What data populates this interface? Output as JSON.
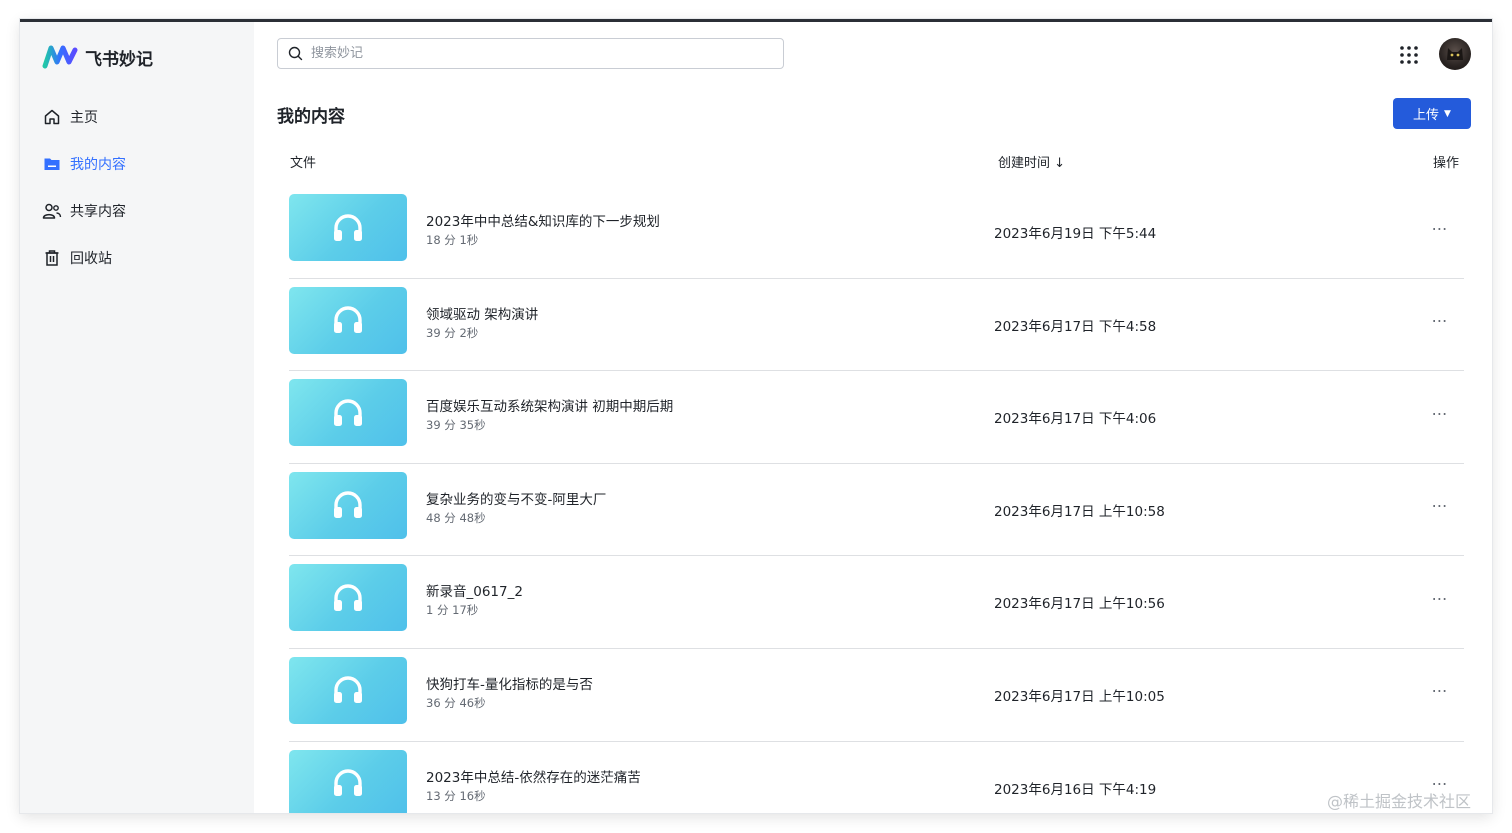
{
  "app": {
    "name": "飞书妙记"
  },
  "sidebar": {
    "items": [
      {
        "label": "主页",
        "icon": "home-icon",
        "active": false
      },
      {
        "label": "我的内容",
        "icon": "folder-icon",
        "active": true
      },
      {
        "label": "共享内容",
        "icon": "users-icon",
        "active": false
      },
      {
        "label": "回收站",
        "icon": "trash-icon",
        "active": false
      }
    ]
  },
  "header": {
    "search_placeholder": "搜索妙记"
  },
  "main": {
    "title": "我的内容",
    "upload_label": "上传",
    "columns": {
      "file": "文件",
      "created": "创建时间 ↓",
      "actions": "操作"
    },
    "rows": [
      {
        "title": "2023年中中总结&知识库的下一步规划",
        "duration": "18 分 1秒",
        "date": "2023年6月19日 下午5:44"
      },
      {
        "title": "领域驱动 架构演讲",
        "duration": "39 分 2秒",
        "date": "2023年6月17日 下午4:58"
      },
      {
        "title": "百度娱乐互动系统架构演讲 初期中期后期",
        "duration": "39 分 35秒",
        "date": "2023年6月17日 下午4:06"
      },
      {
        "title": "复杂业务的变与不变-阿里大厂",
        "duration": "48 分 48秒",
        "date": "2023年6月17日 上午10:58"
      },
      {
        "title": "新录音_0617_2",
        "duration": "1 分 17秒",
        "date": "2023年6月17日 上午10:56"
      },
      {
        "title": "快狗打车-量化指标的是与否",
        "duration": "36 分 46秒",
        "date": "2023年6月17日 上午10:05"
      },
      {
        "title": "2023年中总结-依然存在的迷茫痛苦",
        "duration": "13 分 16秒",
        "date": "2023年6月16日 下午4:19"
      }
    ]
  },
  "watermark": "@稀土掘金技术社区",
  "colors": {
    "accent": "#3370ff",
    "button": "#245bdb",
    "thumb": "#5ccde9"
  }
}
